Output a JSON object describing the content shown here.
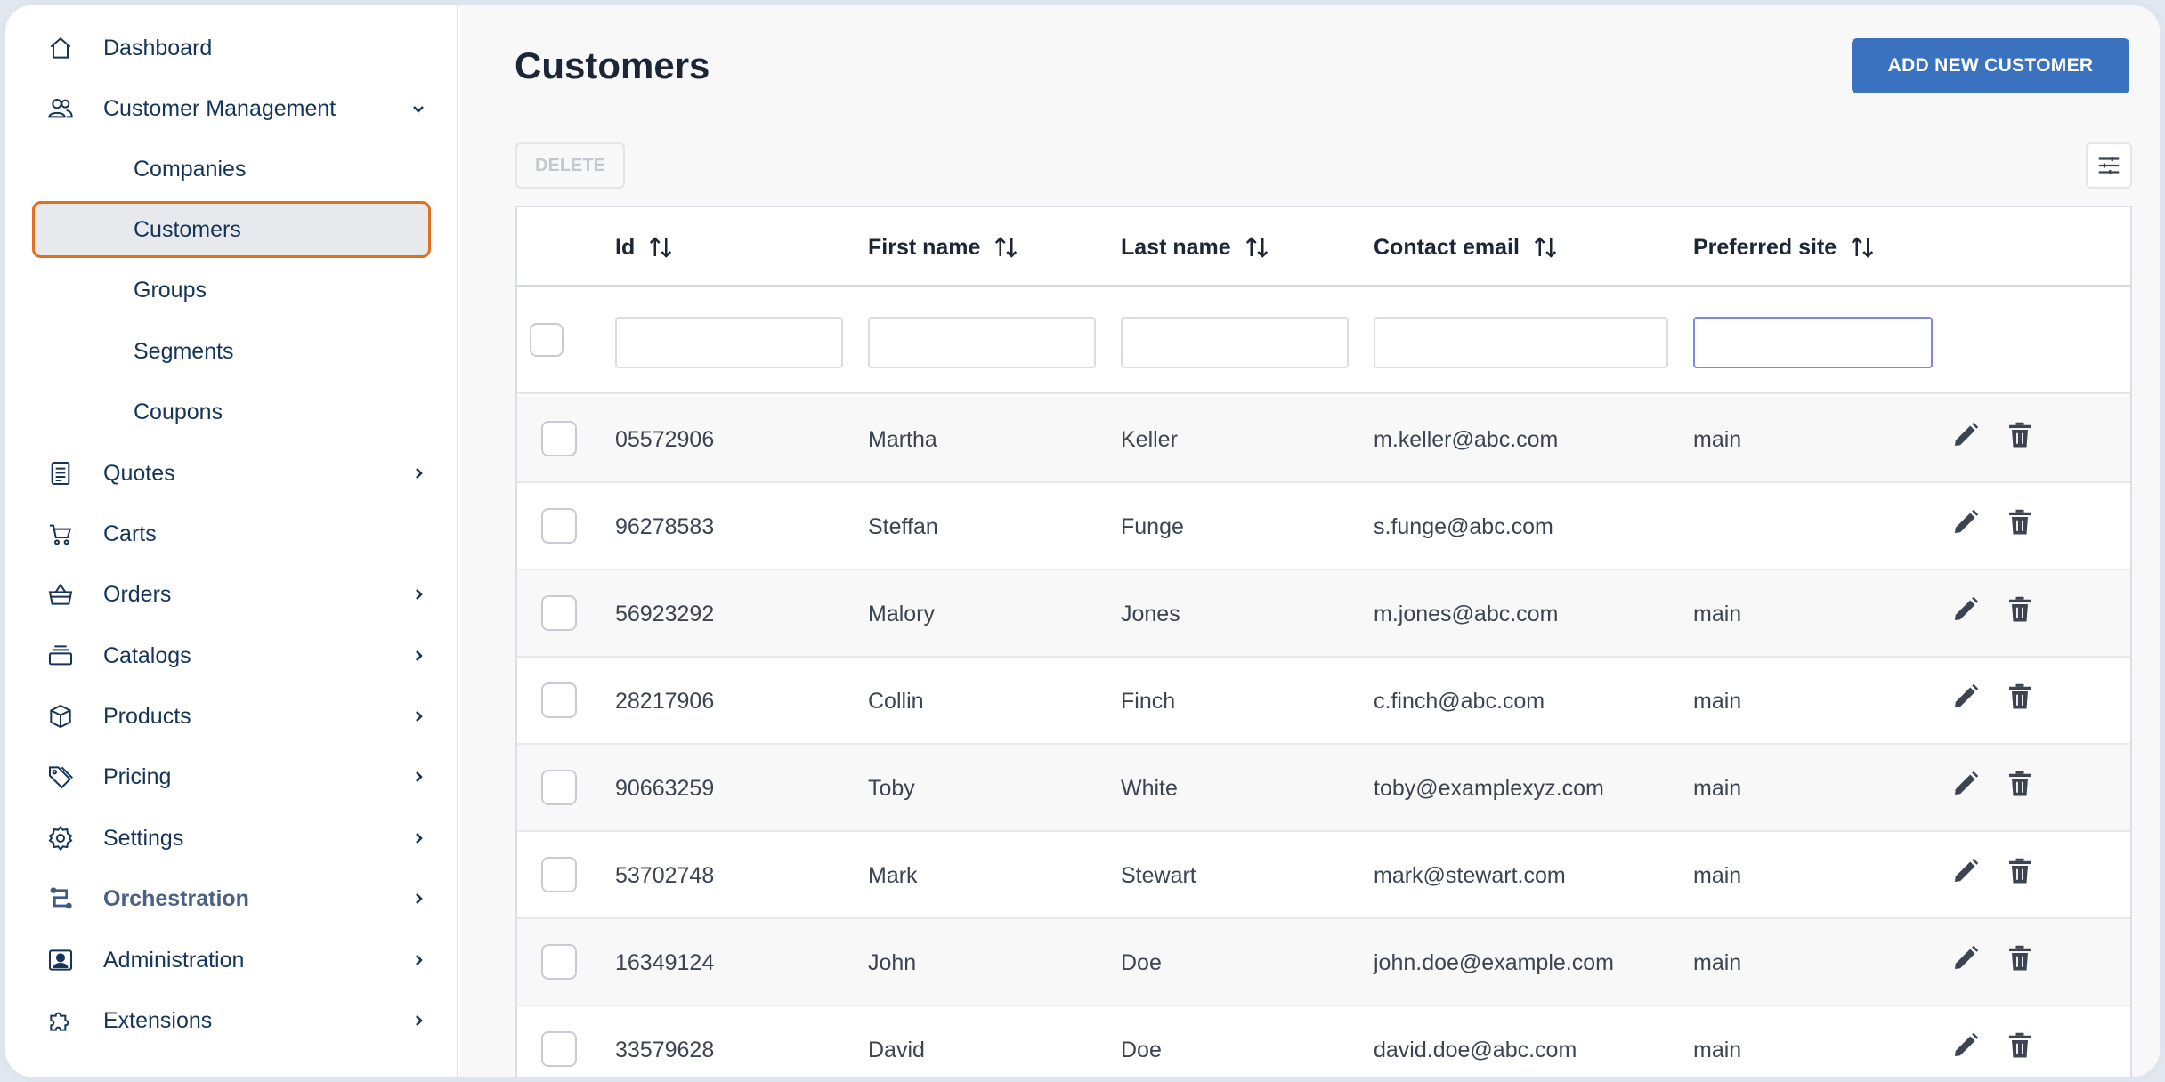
{
  "sidebar": {
    "items": [
      {
        "label": "Dashboard",
        "icon": "home-icon",
        "chevron": ""
      },
      {
        "label": "Customer Management",
        "icon": "users-icon",
        "chevron": "down"
      },
      {
        "label": "Quotes",
        "icon": "document-icon",
        "chevron": "right"
      },
      {
        "label": "Carts",
        "icon": "cart-icon",
        "chevron": ""
      },
      {
        "label": "Orders",
        "icon": "basket-icon",
        "chevron": "right"
      },
      {
        "label": "Catalogs",
        "icon": "layers-icon",
        "chevron": "right"
      },
      {
        "label": "Products",
        "icon": "box-icon",
        "chevron": "right"
      },
      {
        "label": "Pricing",
        "icon": "tag-icon",
        "chevron": "right"
      },
      {
        "label": "Settings",
        "icon": "gear-icon",
        "chevron": "right"
      },
      {
        "label": "Orchestration",
        "icon": "orchestration-icon",
        "chevron": "right"
      },
      {
        "label": "Administration",
        "icon": "admin-icon",
        "chevron": "right"
      },
      {
        "label": "Extensions",
        "icon": "puzzle-icon",
        "chevron": "right"
      }
    ],
    "sub_items": [
      {
        "label": "Companies"
      },
      {
        "label": "Customers",
        "active": true
      },
      {
        "label": "Groups"
      },
      {
        "label": "Segments"
      },
      {
        "label": "Coupons"
      }
    ]
  },
  "main": {
    "title": "Customers",
    "add_button": "ADD NEW CUSTOMER",
    "delete_button": "DELETE",
    "columns": [
      "Id",
      "First name",
      "Last name",
      "Contact email",
      "Preferred site"
    ],
    "rows": [
      {
        "id": "05572906",
        "first": "Martha",
        "last": "Keller",
        "email": "m.keller@abc.com",
        "site": "main"
      },
      {
        "id": "96278583",
        "first": "Steffan",
        "last": "Funge",
        "email": "s.funge@abc.com",
        "site": ""
      },
      {
        "id": "56923292",
        "first": "Malory",
        "last": "Jones",
        "email": "m.jones@abc.com",
        "site": "main"
      },
      {
        "id": "28217906",
        "first": "Collin",
        "last": "Finch",
        "email": "c.finch@abc.com",
        "site": "main"
      },
      {
        "id": "90663259",
        "first": "Toby",
        "last": "White",
        "email": "toby@examplexyz.com",
        "site": "main"
      },
      {
        "id": "53702748",
        "first": "Mark",
        "last": "Stewart",
        "email": "mark@stewart.com",
        "site": "main"
      },
      {
        "id": "16349124",
        "first": "John",
        "last": "Doe",
        "email": "john.doe@example.com",
        "site": "main"
      },
      {
        "id": "33579628",
        "first": "David",
        "last": "Doe",
        "email": "david.doe@abc.com",
        "site": "main"
      }
    ]
  },
  "colors": {
    "accent": "#3a72c0",
    "active_border": "#e07020",
    "nav_text": "#14345a"
  }
}
